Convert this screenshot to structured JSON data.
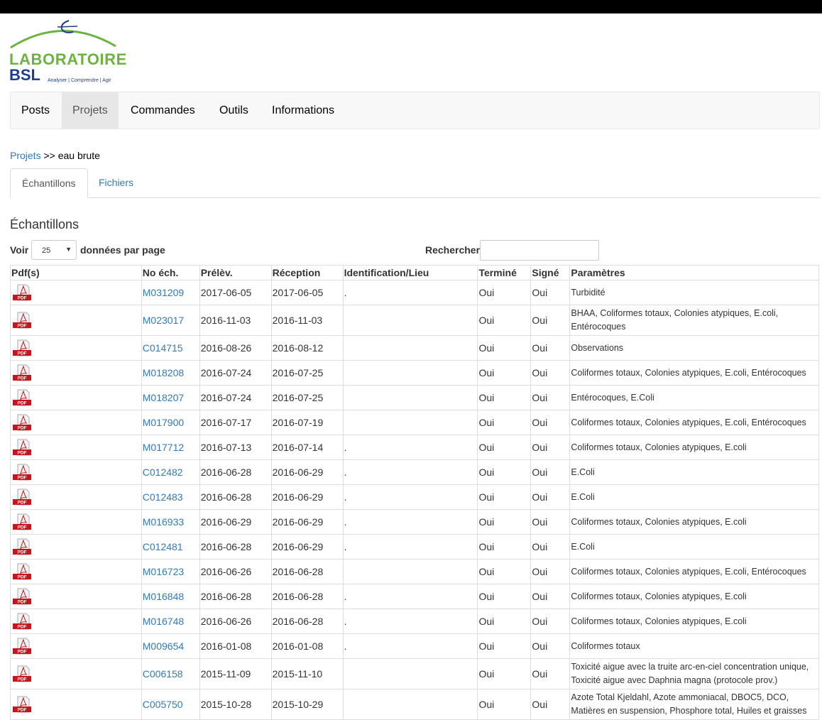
{
  "logo": {
    "line1": "LABORATOIRE",
    "line2": "BSL",
    "tagline": "Analyser | Comprendre | Agir"
  },
  "nav": [
    "Posts",
    "Projets",
    "Commandes",
    "Outils",
    "Informations"
  ],
  "breadcrumb": {
    "link": "Projets",
    "separator": ">>",
    "current": "eau brute"
  },
  "tabs": [
    "Échantillons",
    "Fichiers"
  ],
  "section_title": "Échantillons",
  "controls": {
    "show_label": "Voir",
    "page_size": "25",
    "per_page_label": "données par page",
    "search_label": "Rechercher",
    "search_value": ""
  },
  "table": {
    "headers": [
      "Pdf(s)",
      "No éch.",
      "Prélèv.",
      "Réception",
      "Identification/Lieu",
      "Terminé",
      "Signé",
      "Paramètres"
    ],
    "rows": [
      {
        "no": "M031209",
        "prelev": "2017-06-05",
        "reception": "2017-06-05",
        "ident": ".",
        "termine": "Oui",
        "signe": "Oui",
        "params": "Turbidité"
      },
      {
        "no": "M023017",
        "prelev": "2016-11-03",
        "reception": "2016-11-03",
        "ident": "",
        "termine": "Oui",
        "signe": "Oui",
        "params": "BHAA, Coliformes totaux, Colonies atypiques, E.coli, Entérocoques"
      },
      {
        "no": "C014715",
        "prelev": "2016-08-26",
        "reception": "2016-08-12",
        "ident": "",
        "termine": "Oui",
        "signe": "Oui",
        "params": "Observations"
      },
      {
        "no": "M018208",
        "prelev": "2016-07-24",
        "reception": "2016-07-25",
        "ident": "",
        "termine": "Oui",
        "signe": "Oui",
        "params": "Coliformes totaux, Colonies atypiques, E.coli, Entérocoques"
      },
      {
        "no": "M018207",
        "prelev": "2016-07-24",
        "reception": "2016-07-25",
        "ident": "",
        "termine": "Oui",
        "signe": "Oui",
        "params": "Entérocoques, E.Coli"
      },
      {
        "no": "M017900",
        "prelev": "2016-07-17",
        "reception": "2016-07-19",
        "ident": "",
        "termine": "Oui",
        "signe": "Oui",
        "params": "Coliformes totaux, Colonies atypiques, E.coli, Entérocoques"
      },
      {
        "no": "M017712",
        "prelev": "2016-07-13",
        "reception": "2016-07-14",
        "ident": ".",
        "termine": "Oui",
        "signe": "Oui",
        "params": "Coliformes totaux, Colonies atypiques, E.coli"
      },
      {
        "no": "C012482",
        "prelev": "2016-06-28",
        "reception": "2016-06-29",
        "ident": ".",
        "termine": "Oui",
        "signe": "Oui",
        "params": "E.Coli"
      },
      {
        "no": "C012483",
        "prelev": "2016-06-28",
        "reception": "2016-06-29",
        "ident": ".",
        "termine": "Oui",
        "signe": "Oui",
        "params": "E.Coli"
      },
      {
        "no": "M016933",
        "prelev": "2016-06-29",
        "reception": "2016-06-29",
        "ident": ".",
        "termine": "Oui",
        "signe": "Oui",
        "params": "Coliformes totaux, Colonies atypiques, E.coli"
      },
      {
        "no": "C012481",
        "prelev": "2016-06-28",
        "reception": "2016-06-29",
        "ident": ".",
        "termine": "Oui",
        "signe": "Oui",
        "params": "E.Coli"
      },
      {
        "no": "M016723",
        "prelev": "2016-06-26",
        "reception": "2016-06-28",
        "ident": "",
        "termine": "Oui",
        "signe": "Oui",
        "params": "Coliformes totaux, Colonies atypiques, E.coli, Entérocoques"
      },
      {
        "no": "M016848",
        "prelev": "2016-06-28",
        "reception": "2016-06-28",
        "ident": ".",
        "termine": "Oui",
        "signe": "Oui",
        "params": "Coliformes totaux, Colonies atypiques, E.coli"
      },
      {
        "no": "M016748",
        "prelev": "2016-06-26",
        "reception": "2016-06-28",
        "ident": ".",
        "termine": "Oui",
        "signe": "Oui",
        "params": "Coliformes totaux, Colonies atypiques, E.coli"
      },
      {
        "no": "M009654",
        "prelev": "2016-01-08",
        "reception": "2016-01-08",
        "ident": ".",
        "termine": "Oui",
        "signe": "Oui",
        "params": "Coliformes totaux"
      },
      {
        "no": "C006158",
        "prelev": "2015-11-09",
        "reception": "2015-11-10",
        "ident": "",
        "termine": "Oui",
        "signe": "Oui",
        "params": "Toxicité aigue avec la truite arc-en-ciel concentration unique, Toxicité aigue avec Daphnia magna (protocole prov.)"
      },
      {
        "no": "C005750",
        "prelev": "2015-10-28",
        "reception": "2015-10-29",
        "ident": "",
        "termine": "Oui",
        "signe": "Oui",
        "params": "Azote Total Kjeldahl, Azote ammoniacal, DBOC5, DCO, Matières en suspension, Phosphore total, Huiles et graisses"
      }
    ]
  },
  "colors": {
    "link": "#337ab7",
    "logo_green": "#6cb33f",
    "logo_blue": "#1f3f8a",
    "pdf_red": "#c4161c"
  }
}
